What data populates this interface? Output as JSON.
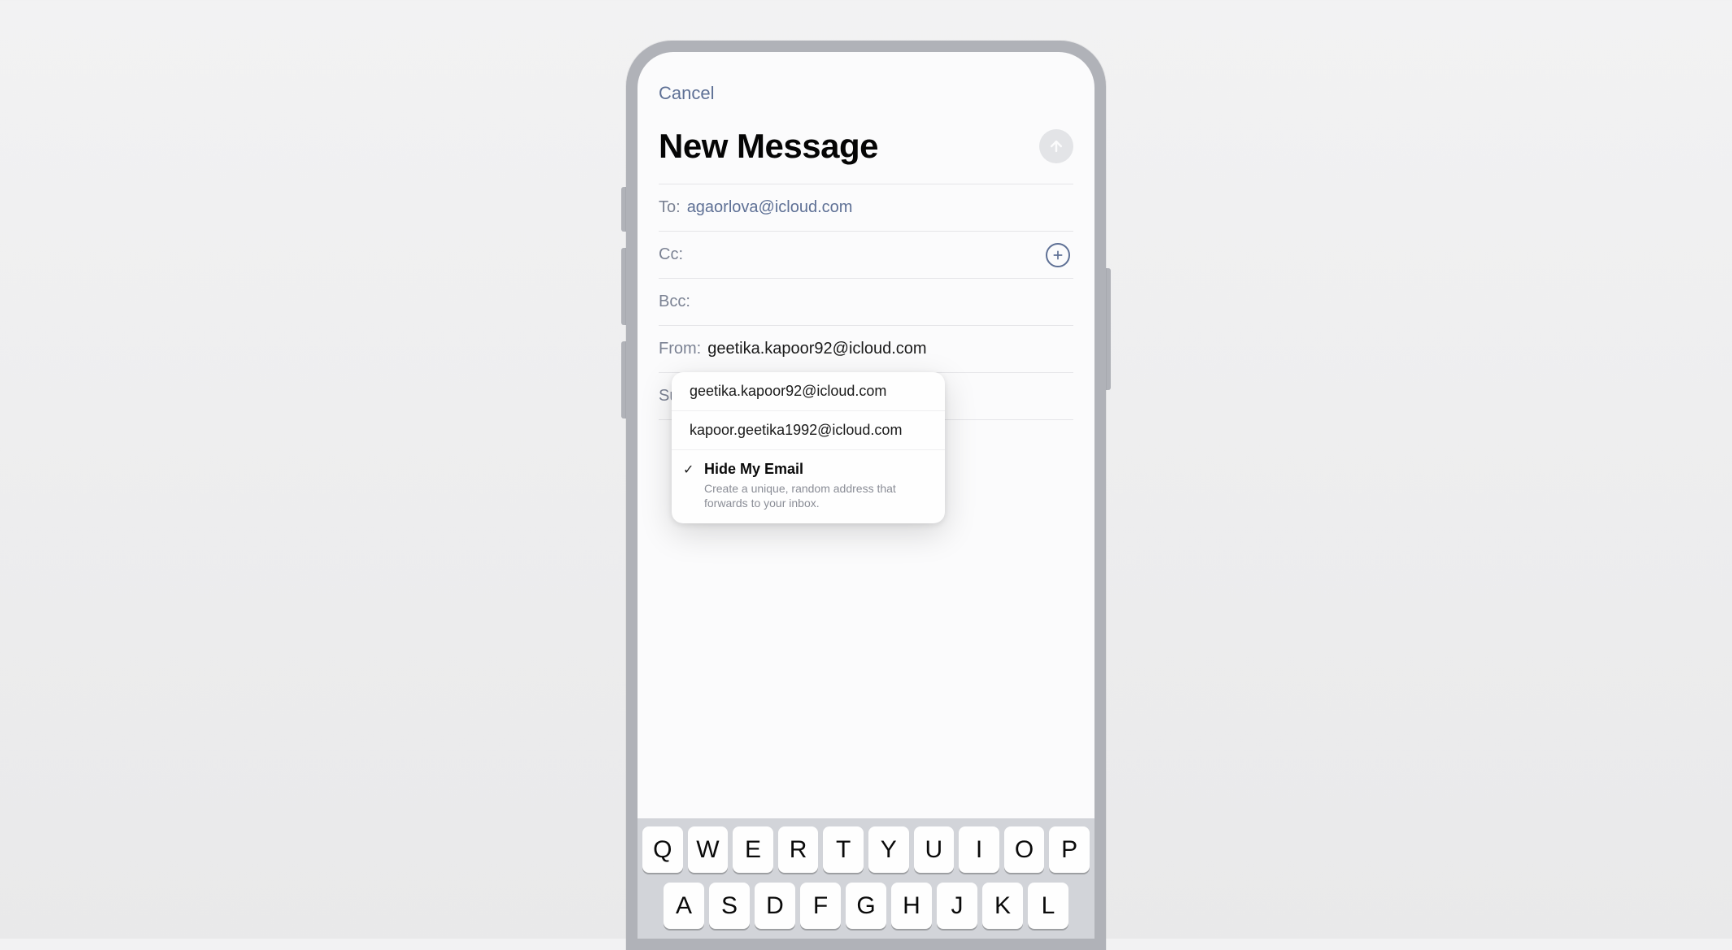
{
  "header": {
    "cancel_label": "Cancel",
    "title": "New Message"
  },
  "fields": {
    "to_label": "To:",
    "to_value": "agaorlova@icloud.com",
    "cc_label": "Cc:",
    "cc_value": "",
    "bcc_label": "Bcc:",
    "bcc_value": "",
    "from_label": "From:",
    "from_value": "geetika.kapoor92@icloud.com",
    "subject_label_partial": "Su"
  },
  "from_dropdown": {
    "options": [
      "geetika.kapoor92@icloud.com",
      "kapoor.geetika1992@icloud.com"
    ],
    "hide_my_email": {
      "checkmark": "✓",
      "title": "Hide My Email",
      "subtitle": "Create a unique, random address that forwards to your inbox."
    }
  },
  "keyboard": {
    "row1": [
      "Q",
      "W",
      "E",
      "R",
      "T",
      "Y",
      "U",
      "I",
      "O",
      "P"
    ],
    "row2": [
      "A",
      "S",
      "D",
      "F",
      "G",
      "H",
      "J",
      "K",
      "L"
    ]
  }
}
